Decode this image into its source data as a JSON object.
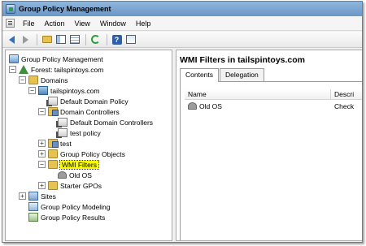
{
  "window": {
    "title": "Group Policy Management"
  },
  "menu": {
    "items": [
      "File",
      "Action",
      "View",
      "Window",
      "Help"
    ]
  },
  "toolbar": {
    "buttons": [
      "back-icon",
      "forward-icon",
      "up-folder-icon",
      "show-hide-tree-icon",
      "list-view-icon",
      "refresh-icon",
      "help-icon",
      "properties-icon"
    ]
  },
  "tree": {
    "root": "Group Policy Management",
    "forest": "Forest: tailspintoys.com",
    "domains": "Domains",
    "domain": "tailspintoys.com",
    "default_domain_policy": "Default Domain Policy",
    "domain_controllers": "Domain Controllers",
    "default_domain_controllers": "Default Domain Controllers",
    "test_policy": "test policy",
    "test": "test",
    "group_policy_objects": "Group Policy Objects",
    "wmi_filters": "WMI Filters",
    "old_os": "Old OS",
    "starter_gpos": "Starter GPOs",
    "sites": "Sites",
    "modeling": "Group Policy Modeling",
    "results": "Group Policy Results",
    "highlight_color": "#fbfb00"
  },
  "details": {
    "title": "WMI Filters in tailspintoys.com",
    "tabs": [
      "Contents",
      "Delegation"
    ],
    "columns": [
      "Name",
      "Descri"
    ],
    "rows": [
      {
        "name": "Old OS",
        "description": "Check"
      }
    ]
  }
}
